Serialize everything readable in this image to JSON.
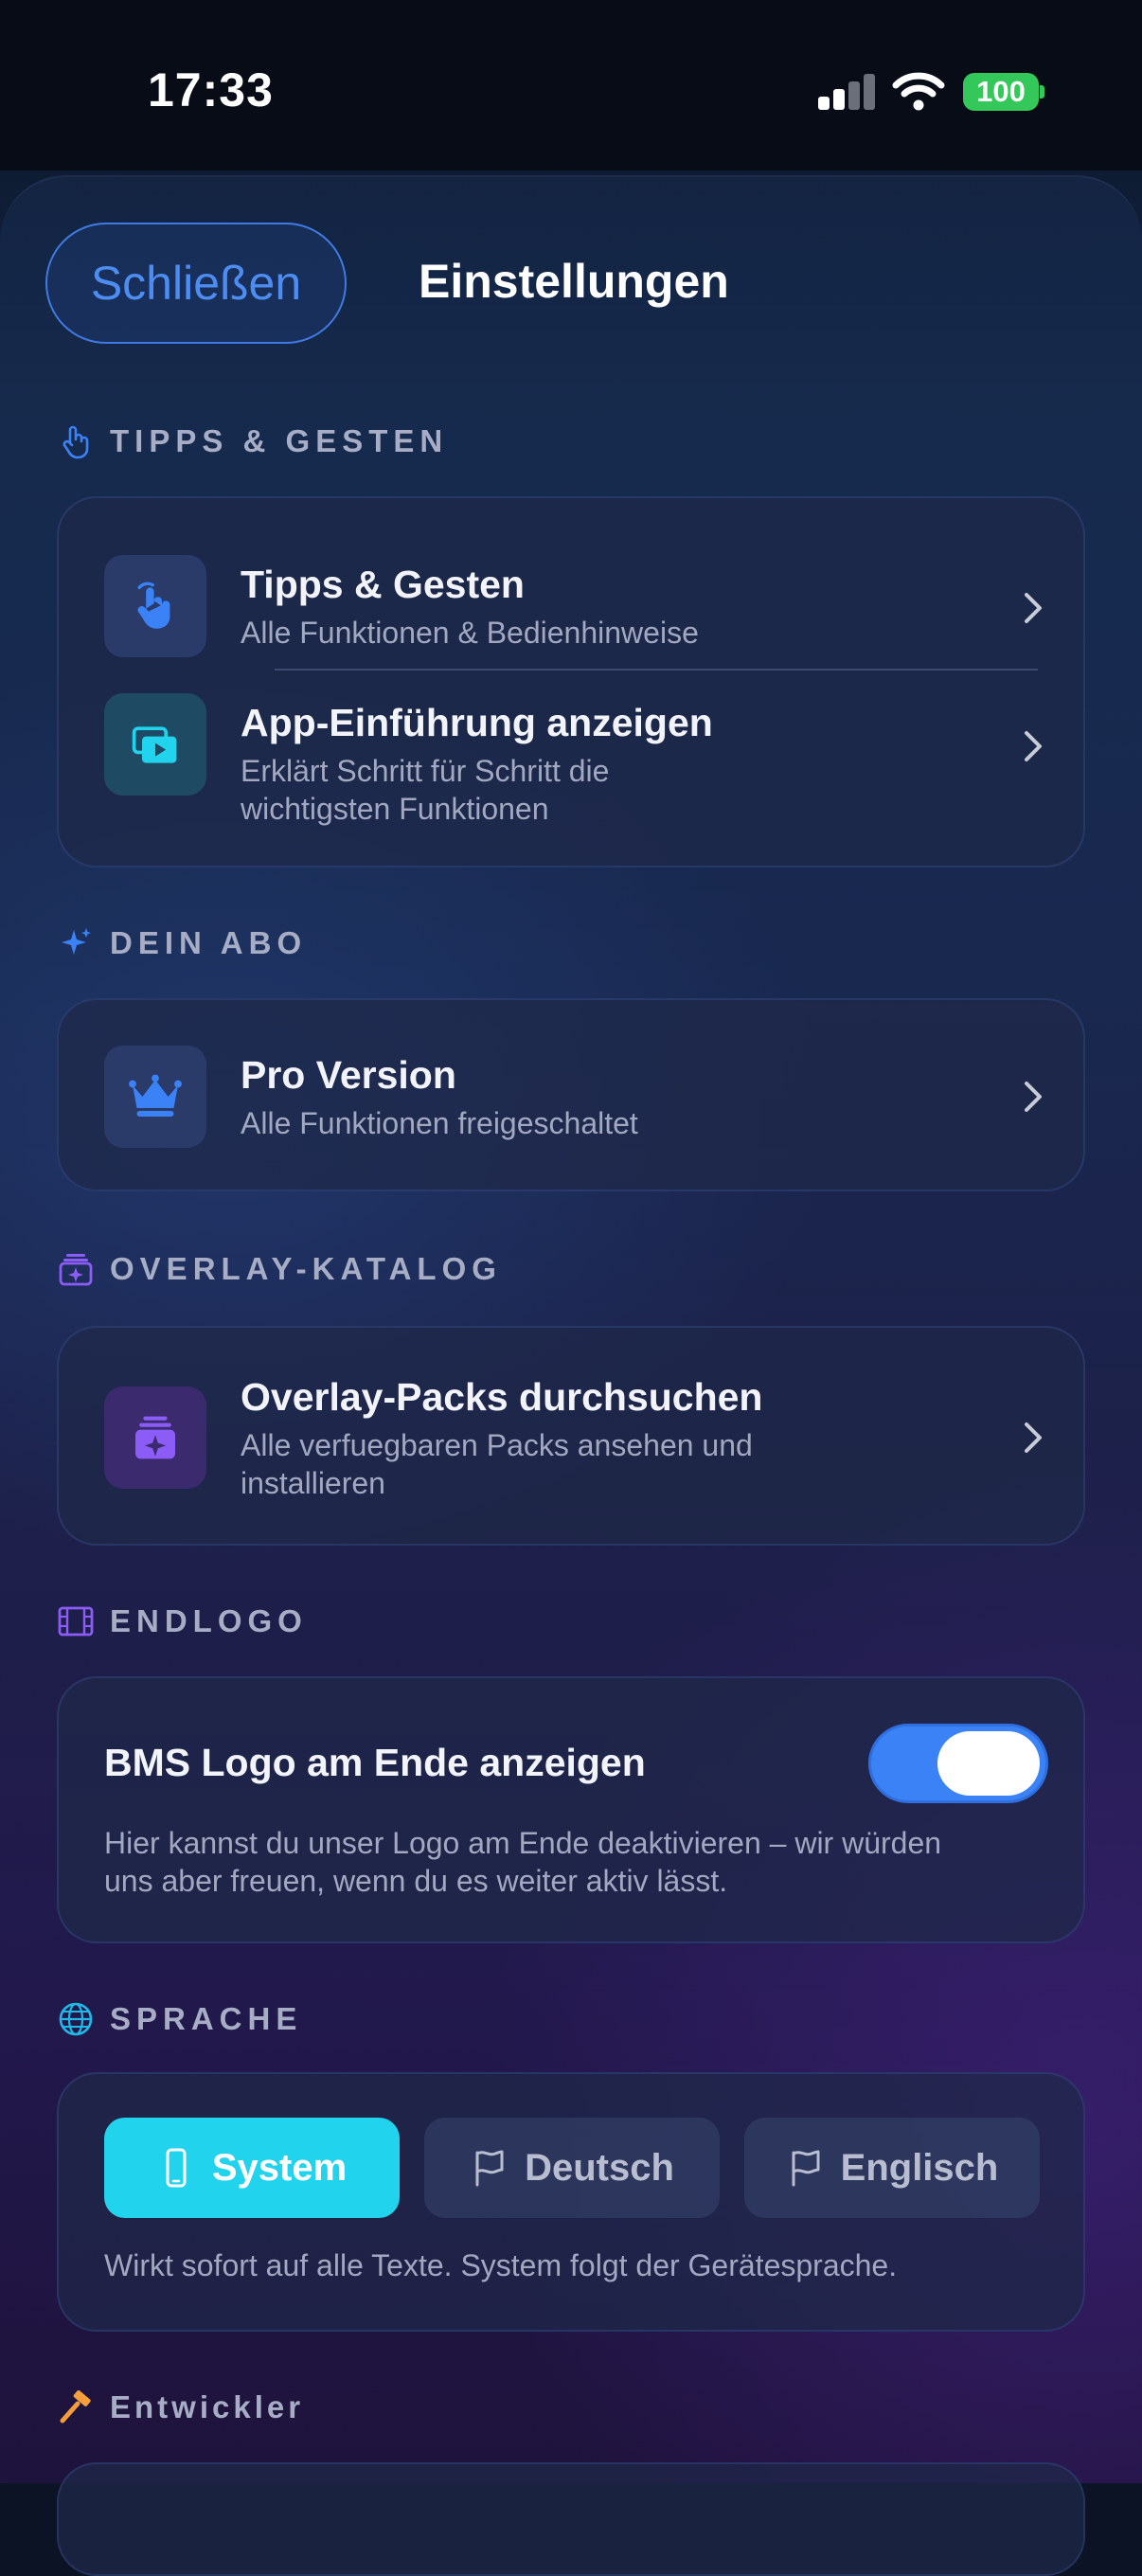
{
  "status_bar": {
    "time": "17:33",
    "battery": "100"
  },
  "header": {
    "close_label": "Schließen",
    "title": "Einstellungen"
  },
  "sections": {
    "tips": {
      "header": "TIPPS & GESTEN",
      "items": [
        {
          "title": "Tipps & Gesten",
          "subtitle": "Alle Funktionen & Bedienhinweise",
          "icon": "hand-point-icon"
        },
        {
          "title": "App-Einführung anzeigen",
          "subtitle_line1": "Erklärt Schritt für Schritt die",
          "subtitle_line2": "wichtigsten Funktionen",
          "icon": "play-slides-icon"
        }
      ]
    },
    "subscription": {
      "header": "DEIN ABO",
      "item": {
        "title": "Pro Version",
        "subtitle": "Alle Funktionen freigeschaltet",
        "icon": "crown-icon"
      }
    },
    "overlay": {
      "header": "OVERLAY-KATALOG",
      "item": {
        "title": "Overlay-Packs durchsuchen",
        "subtitle_line1": "Alle verfuegbaren Packs ansehen und",
        "subtitle_line2": "installieren",
        "icon": "sparkle-stack-icon"
      }
    },
    "endlogo": {
      "header": "ENDLOGO",
      "toggle_label": "BMS Logo am Ende anzeigen",
      "toggle_on": true,
      "description_line1": "Hier kannst du unser Logo am Ende deaktivieren – wir würden",
      "description_line2": "uns aber freuen, wenn du es weiter aktiv lässt."
    },
    "language": {
      "header": "SPRACHE",
      "options": [
        {
          "label": "System",
          "icon": "phone-icon",
          "selected": true
        },
        {
          "label": "Deutsch",
          "icon": "flag-icon",
          "selected": false
        },
        {
          "label": "Englisch",
          "icon": "flag-icon",
          "selected": false
        }
      ],
      "hint": "Wirkt sofort auf alle Texte. System folgt der Gerätesprache."
    },
    "developer": {
      "header": "Entwickler",
      "icon": "hammer-icon"
    }
  },
  "colors": {
    "accent_blue": "#3b82f6",
    "accent_cyan": "#22d3ee",
    "accent_purple": "#8b5cf6",
    "accent_orange": "#f59e3b",
    "battery_green": "#34c759"
  }
}
